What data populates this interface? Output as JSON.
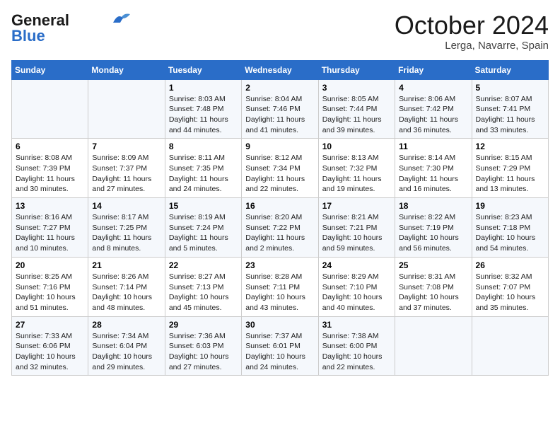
{
  "header": {
    "logo_general": "General",
    "logo_blue": "Blue",
    "month_title": "October 2024",
    "location": "Lerga, Navarre, Spain"
  },
  "days_of_week": [
    "Sunday",
    "Monday",
    "Tuesday",
    "Wednesday",
    "Thursday",
    "Friday",
    "Saturday"
  ],
  "weeks": [
    [
      {
        "day": "",
        "info": ""
      },
      {
        "day": "",
        "info": ""
      },
      {
        "day": "1",
        "info": "Sunrise: 8:03 AM\nSunset: 7:48 PM\nDaylight: 11 hours\nand 44 minutes."
      },
      {
        "day": "2",
        "info": "Sunrise: 8:04 AM\nSunset: 7:46 PM\nDaylight: 11 hours\nand 41 minutes."
      },
      {
        "day": "3",
        "info": "Sunrise: 8:05 AM\nSunset: 7:44 PM\nDaylight: 11 hours\nand 39 minutes."
      },
      {
        "day": "4",
        "info": "Sunrise: 8:06 AM\nSunset: 7:42 PM\nDaylight: 11 hours\nand 36 minutes."
      },
      {
        "day": "5",
        "info": "Sunrise: 8:07 AM\nSunset: 7:41 PM\nDaylight: 11 hours\nand 33 minutes."
      }
    ],
    [
      {
        "day": "6",
        "info": "Sunrise: 8:08 AM\nSunset: 7:39 PM\nDaylight: 11 hours\nand 30 minutes."
      },
      {
        "day": "7",
        "info": "Sunrise: 8:09 AM\nSunset: 7:37 PM\nDaylight: 11 hours\nand 27 minutes."
      },
      {
        "day": "8",
        "info": "Sunrise: 8:11 AM\nSunset: 7:35 PM\nDaylight: 11 hours\nand 24 minutes."
      },
      {
        "day": "9",
        "info": "Sunrise: 8:12 AM\nSunset: 7:34 PM\nDaylight: 11 hours\nand 22 minutes."
      },
      {
        "day": "10",
        "info": "Sunrise: 8:13 AM\nSunset: 7:32 PM\nDaylight: 11 hours\nand 19 minutes."
      },
      {
        "day": "11",
        "info": "Sunrise: 8:14 AM\nSunset: 7:30 PM\nDaylight: 11 hours\nand 16 minutes."
      },
      {
        "day": "12",
        "info": "Sunrise: 8:15 AM\nSunset: 7:29 PM\nDaylight: 11 hours\nand 13 minutes."
      }
    ],
    [
      {
        "day": "13",
        "info": "Sunrise: 8:16 AM\nSunset: 7:27 PM\nDaylight: 11 hours\nand 10 minutes."
      },
      {
        "day": "14",
        "info": "Sunrise: 8:17 AM\nSunset: 7:25 PM\nDaylight: 11 hours\nand 8 minutes."
      },
      {
        "day": "15",
        "info": "Sunrise: 8:19 AM\nSunset: 7:24 PM\nDaylight: 11 hours\nand 5 minutes."
      },
      {
        "day": "16",
        "info": "Sunrise: 8:20 AM\nSunset: 7:22 PM\nDaylight: 11 hours\nand 2 minutes."
      },
      {
        "day": "17",
        "info": "Sunrise: 8:21 AM\nSunset: 7:21 PM\nDaylight: 10 hours\nand 59 minutes."
      },
      {
        "day": "18",
        "info": "Sunrise: 8:22 AM\nSunset: 7:19 PM\nDaylight: 10 hours\nand 56 minutes."
      },
      {
        "day": "19",
        "info": "Sunrise: 8:23 AM\nSunset: 7:18 PM\nDaylight: 10 hours\nand 54 minutes."
      }
    ],
    [
      {
        "day": "20",
        "info": "Sunrise: 8:25 AM\nSunset: 7:16 PM\nDaylight: 10 hours\nand 51 minutes."
      },
      {
        "day": "21",
        "info": "Sunrise: 8:26 AM\nSunset: 7:14 PM\nDaylight: 10 hours\nand 48 minutes."
      },
      {
        "day": "22",
        "info": "Sunrise: 8:27 AM\nSunset: 7:13 PM\nDaylight: 10 hours\nand 45 minutes."
      },
      {
        "day": "23",
        "info": "Sunrise: 8:28 AM\nSunset: 7:11 PM\nDaylight: 10 hours\nand 43 minutes."
      },
      {
        "day": "24",
        "info": "Sunrise: 8:29 AM\nSunset: 7:10 PM\nDaylight: 10 hours\nand 40 minutes."
      },
      {
        "day": "25",
        "info": "Sunrise: 8:31 AM\nSunset: 7:08 PM\nDaylight: 10 hours\nand 37 minutes."
      },
      {
        "day": "26",
        "info": "Sunrise: 8:32 AM\nSunset: 7:07 PM\nDaylight: 10 hours\nand 35 minutes."
      }
    ],
    [
      {
        "day": "27",
        "info": "Sunrise: 7:33 AM\nSunset: 6:06 PM\nDaylight: 10 hours\nand 32 minutes."
      },
      {
        "day": "28",
        "info": "Sunrise: 7:34 AM\nSunset: 6:04 PM\nDaylight: 10 hours\nand 29 minutes."
      },
      {
        "day": "29",
        "info": "Sunrise: 7:36 AM\nSunset: 6:03 PM\nDaylight: 10 hours\nand 27 minutes."
      },
      {
        "day": "30",
        "info": "Sunrise: 7:37 AM\nSunset: 6:01 PM\nDaylight: 10 hours\nand 24 minutes."
      },
      {
        "day": "31",
        "info": "Sunrise: 7:38 AM\nSunset: 6:00 PM\nDaylight: 10 hours\nand 22 minutes."
      },
      {
        "day": "",
        "info": ""
      },
      {
        "day": "",
        "info": ""
      }
    ]
  ]
}
